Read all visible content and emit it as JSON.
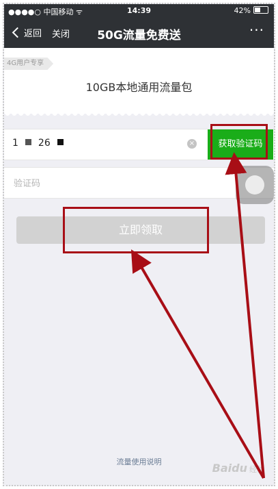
{
  "status_bar": {
    "carrier": "●●●●○ 中国移动 ᯤ",
    "time": "14:39",
    "battery": "42%"
  },
  "nav": {
    "back_label": "返回",
    "close_label": "关闭",
    "title": "50G流量免费送",
    "more_label": "···"
  },
  "package": {
    "tag": "4G用户专享",
    "name": "10GB本地通用流量包"
  },
  "form": {
    "phone_prefix": "1",
    "phone_middle": "26",
    "get_code_label": "获取验证码",
    "code_placeholder": "验证码",
    "claim_label": "立即领取"
  },
  "footer": {
    "usage_link": "流量使用说明"
  },
  "watermark": {
    "brand": "Baidu",
    "sub": "经验"
  },
  "colors": {
    "nav_bg": "#2e3135",
    "accent_green": "#1aad19",
    "annotation_red": "#a80e16"
  }
}
